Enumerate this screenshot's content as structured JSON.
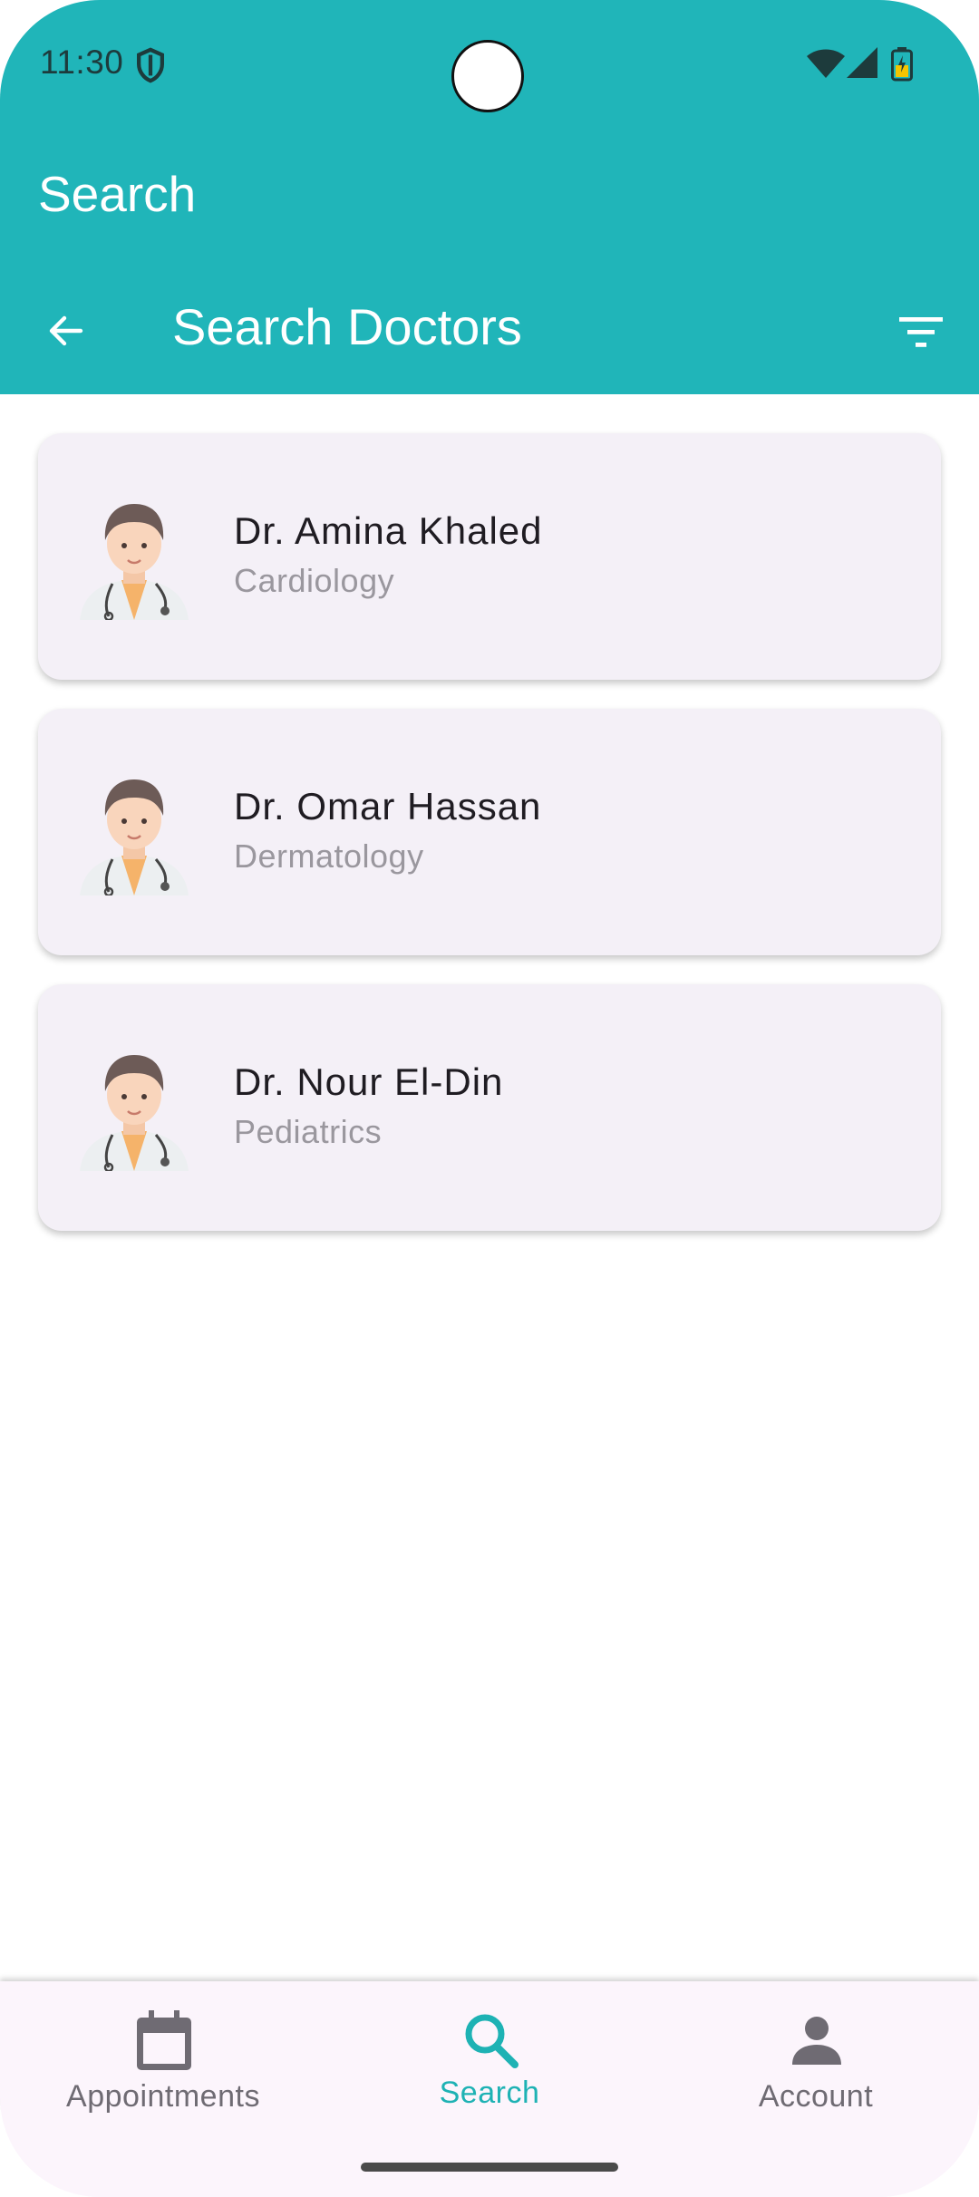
{
  "status_bar": {
    "time": "11:30",
    "icons": [
      "shield-icon",
      "wifi-icon",
      "cell-signal-icon",
      "battery-charging-icon"
    ]
  },
  "app_bar": {
    "title": "Search"
  },
  "toolbar": {
    "back_icon": "arrow-back-icon",
    "title": "Search Doctors",
    "filter_icon": "filter-icon"
  },
  "doctors": [
    {
      "name": "Dr. Amina Khaled",
      "specialty": "Cardiology",
      "avatar": "doctor-avatar-icon"
    },
    {
      "name": "Dr. Omar Hassan",
      "specialty": "Dermatology",
      "avatar": "doctor-avatar-icon"
    },
    {
      "name": "Dr. Nour El-Din",
      "specialty": "Pediatrics",
      "avatar": "doctor-avatar-icon"
    }
  ],
  "bottom_nav": {
    "items": [
      {
        "label": "Appointments",
        "icon": "calendar-icon",
        "active": false
      },
      {
        "label": "Search",
        "icon": "search-icon",
        "active": true
      },
      {
        "label": "Account",
        "icon": "person-icon",
        "active": false
      }
    ]
  },
  "colors": {
    "primary": "#20b5b9",
    "card_bg": "#f4f0f7",
    "nav_bg": "#fcf5fc",
    "active_tab": "#1eb2b4"
  }
}
